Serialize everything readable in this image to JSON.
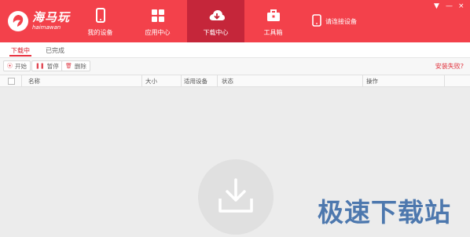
{
  "app": {
    "logo_cn": "海马玩",
    "logo_en": "haimawan"
  },
  "nav": [
    {
      "id": "my-device",
      "label": "我的设备",
      "icon": "phone-icon"
    },
    {
      "id": "app-center",
      "label": "应用中心",
      "icon": "grid-icon"
    },
    {
      "id": "download-center",
      "label": "下载中心",
      "icon": "cloud-download-icon",
      "active": true
    },
    {
      "id": "toolbox",
      "label": "工具箱",
      "icon": "briefcase-icon"
    }
  ],
  "connect": {
    "label": "请连接设备",
    "icon": "phone-icon"
  },
  "window_controls": {
    "menu": "▼",
    "minimize": "—",
    "close": "×"
  },
  "subtabs": [
    {
      "label": "下载中",
      "active": true
    },
    {
      "label": "已完成",
      "active": false
    }
  ],
  "toolbar": {
    "start": "开始",
    "pause": "暂停",
    "delete": "删除",
    "failed_link": "安装失败?"
  },
  "table": {
    "columns": [
      "名称",
      "大小",
      "适用设备",
      "状态",
      "操作"
    ]
  },
  "empty_state": {
    "icon": "download-tray-icon"
  },
  "watermark": "极速下载站",
  "colors": {
    "header": "#f3414b",
    "active_tab": "#c5263a",
    "accent": "#e8303e",
    "watermark": "#4d78ae"
  }
}
